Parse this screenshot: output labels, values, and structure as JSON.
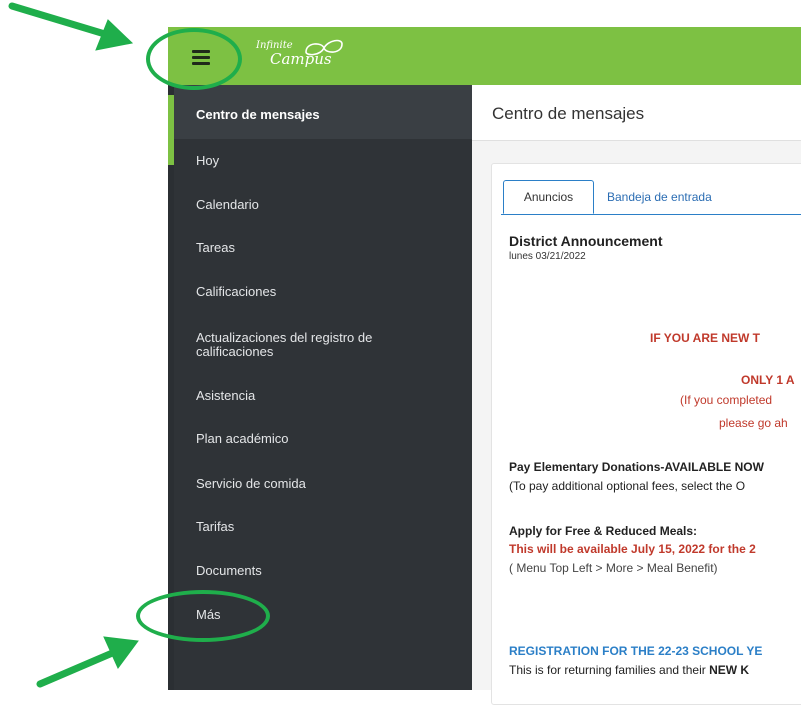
{
  "app": {
    "logo_top": "Infinite",
    "logo_bottom": "Campus"
  },
  "sidebar": {
    "items": [
      {
        "label": "Centro de mensajes",
        "active": true
      },
      {
        "label": "Hoy"
      },
      {
        "label": "Calendario"
      },
      {
        "label": "Tareas"
      },
      {
        "label": "Calificaciones"
      },
      {
        "label": "Actualizaciones del registro de calificaciones"
      },
      {
        "label": "Asistencia"
      },
      {
        "label": "Plan académico"
      },
      {
        "label": "Servicio de comida"
      },
      {
        "label": "Tarifas"
      },
      {
        "label": "Documents"
      },
      {
        "label": "Más"
      }
    ]
  },
  "main": {
    "page_title": "Centro de mensajes",
    "tabs": [
      {
        "label": "Anuncios",
        "active": true
      },
      {
        "label": "Bandeja de entrada"
      }
    ],
    "announcement": {
      "title": "District Announcement",
      "date": "lunes 03/21/2022",
      "line_new": "IF YOU ARE NEW T",
      "line_only": "ONLY 1 A",
      "line_completed": "(If you completed",
      "line_please": "please go ah",
      "pay_heading": "Pay Elementary Donations-AVAILABLE NOW",
      "pay_text": "(To pay additional optional fees, select the O",
      "meals_heading": "Apply for Free & Reduced Meals:",
      "meals_red": "This will be available July 15, 2022 for the 2",
      "meals_path": "( Menu Top Left > More > Meal Benefit)",
      "reg_heading": "REGISTRATION FOR THE 22-23 SCHOOL YE",
      "reg_text_pre": "This is for returning families and their ",
      "reg_text_bold": "NEW K"
    }
  },
  "colors": {
    "brand_green": "#7dc143",
    "sidebar_bg": "#2f3337",
    "annotation_green": "#1fae4b",
    "link_blue": "#2b7fc7",
    "alert_red": "#c0392b"
  },
  "icons": {
    "menu": "hamburger-menu-icon",
    "logo": "infinite-campus-logo"
  }
}
